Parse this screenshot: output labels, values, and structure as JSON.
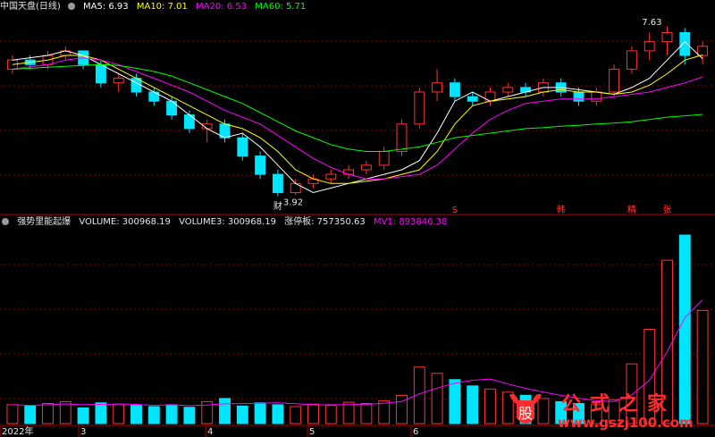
{
  "header": {
    "title": "中国天盘(日线)",
    "ma5": "MA5: 6.93",
    "ma10": "MA10: 7.01",
    "ma20": "MA20: 6.53",
    "ma60": "MA60: 5.71"
  },
  "indicator": {
    "name": "强势里能起爆",
    "volume": "VOLUME: 300968.19",
    "volume3": "VOLUME3: 300968.19",
    "zt": "涨停板: 757350.63",
    "mv1": "MV1: 893846.38"
  },
  "annotations": {
    "high": "7.63",
    "low": "3.92",
    "marker": "财",
    "signals": [
      "S",
      "韩",
      "精",
      "张"
    ]
  },
  "xaxis": [
    "2022年",
    "3",
    "4",
    "5",
    "6"
  ],
  "watermark": {
    "text": "公式之家",
    "url": "www.gszj100.com",
    "logo": "股"
  },
  "colors": {
    "up": "#ff3333",
    "down": "#00e5ff",
    "ma5": "#ffffff",
    "ma10": "#ffff00",
    "ma20": "#ff00ff",
    "ma60": "#00ff00",
    "grid": "#8b0000"
  },
  "chart_data": [
    {
      "type": "candlestick",
      "series": [
        {
          "name": "MA5",
          "values": [
            6.9,
            6.95,
            7.0,
            7.1,
            7.0,
            6.8,
            6.6,
            6.4,
            6.2,
            6.0,
            5.7,
            5.4,
            5.2,
            5.3,
            5.0,
            4.6,
            4.2,
            4.0,
            4.1,
            4.2,
            4.3,
            4.4,
            4.5,
            4.7,
            5.3,
            6.0,
            6.2,
            6.0,
            6.1,
            6.2,
            6.3,
            6.3,
            6.25,
            6.2,
            6.15,
            6.3,
            6.5,
            6.9,
            7.3,
            6.93
          ]
        },
        {
          "name": "MA10",
          "values": [
            6.8,
            6.85,
            6.9,
            7.0,
            7.0,
            6.9,
            6.7,
            6.5,
            6.3,
            6.1,
            5.9,
            5.7,
            5.5,
            5.4,
            5.2,
            4.9,
            4.5,
            4.3,
            4.2,
            4.2,
            4.25,
            4.3,
            4.4,
            4.5,
            4.9,
            5.5,
            5.9,
            6.0,
            6.05,
            6.1,
            6.2,
            6.25,
            6.2,
            6.2,
            6.15,
            6.2,
            6.35,
            6.6,
            6.9,
            7.01
          ]
        },
        {
          "name": "MA20",
          "values": [
            6.7,
            6.75,
            6.8,
            6.9,
            6.95,
            6.9,
            6.8,
            6.65,
            6.5,
            6.35,
            6.2,
            6.0,
            5.8,
            5.65,
            5.5,
            5.25,
            5.0,
            4.75,
            4.55,
            4.4,
            4.3,
            4.3,
            4.35,
            4.4,
            4.6,
            4.95,
            5.3,
            5.6,
            5.8,
            5.95,
            6.0,
            6.05,
            6.05,
            6.05,
            6.1,
            6.15,
            6.2,
            6.3,
            6.4,
            6.53
          ]
        },
        {
          "name": "MA60",
          "values": [
            6.7,
            6.72,
            6.74,
            6.76,
            6.78,
            6.8,
            6.78,
            6.72,
            6.65,
            6.55,
            6.4,
            6.25,
            6.1,
            5.95,
            5.75,
            5.55,
            5.35,
            5.2,
            5.05,
            4.95,
            4.9,
            4.9,
            4.95,
            5.0,
            5.1,
            5.2,
            5.25,
            5.3,
            5.35,
            5.4,
            5.42,
            5.45,
            5.47,
            5.5,
            5.52,
            5.55,
            5.6,
            5.65,
            5.68,
            5.71
          ]
        }
      ],
      "candles": [
        [
          6.7,
          7.0,
          6.6,
          6.9
        ],
        [
          6.9,
          7.0,
          6.7,
          6.8
        ],
        [
          6.8,
          7.1,
          6.7,
          7.0
        ],
        [
          7.0,
          7.2,
          6.9,
          7.1
        ],
        [
          7.1,
          7.1,
          6.7,
          6.8
        ],
        [
          6.8,
          6.9,
          6.3,
          6.4
        ],
        [
          6.4,
          6.6,
          6.2,
          6.5
        ],
        [
          6.5,
          6.6,
          6.1,
          6.2
        ],
        [
          6.2,
          6.3,
          5.9,
          6.0
        ],
        [
          6.0,
          6.1,
          5.6,
          5.7
        ],
        [
          5.7,
          5.8,
          5.3,
          5.4
        ],
        [
          5.4,
          5.6,
          5.1,
          5.5
        ],
        [
          5.5,
          5.6,
          5.1,
          5.2
        ],
        [
          5.2,
          5.3,
          4.7,
          4.8
        ],
        [
          4.8,
          4.9,
          4.3,
          4.4
        ],
        [
          4.4,
          4.5,
          3.92,
          4.0
        ],
        [
          4.0,
          4.3,
          3.95,
          4.2
        ],
        [
          4.2,
          4.4,
          4.1,
          4.3
        ],
        [
          4.3,
          4.5,
          4.2,
          4.4
        ],
        [
          4.4,
          4.6,
          4.3,
          4.5
        ],
        [
          4.5,
          4.7,
          4.4,
          4.6
        ],
        [
          4.6,
          5.0,
          4.5,
          4.9
        ],
        [
          4.9,
          5.6,
          4.8,
          5.5
        ],
        [
          5.5,
          6.3,
          5.4,
          6.2
        ],
        [
          6.2,
          6.7,
          6.0,
          6.4
        ],
        [
          6.4,
          6.5,
          6.0,
          6.1
        ],
        [
          6.1,
          6.2,
          5.9,
          6.0
        ],
        [
          6.0,
          6.3,
          5.9,
          6.2
        ],
        [
          6.2,
          6.4,
          6.1,
          6.3
        ],
        [
          6.3,
          6.4,
          6.1,
          6.2
        ],
        [
          6.2,
          6.5,
          6.1,
          6.4
        ],
        [
          6.4,
          6.5,
          6.1,
          6.2
        ],
        [
          6.2,
          6.3,
          5.9,
          6.0
        ],
        [
          6.0,
          6.3,
          5.9,
          6.2
        ],
        [
          6.2,
          6.8,
          6.1,
          6.7
        ],
        [
          6.7,
          7.2,
          6.6,
          7.1
        ],
        [
          7.1,
          7.5,
          6.9,
          7.3
        ],
        [
          7.3,
          7.63,
          7.0,
          7.5
        ],
        [
          7.5,
          7.6,
          6.8,
          7.0
        ],
        [
          7.0,
          7.3,
          6.8,
          7.2
        ]
      ],
      "ylim": [
        3.6,
        7.9
      ]
    },
    {
      "type": "bar",
      "volumes": [
        30,
        28,
        32,
        35,
        25,
        33,
        31,
        29,
        27,
        30,
        26,
        35,
        40,
        28,
        33,
        30,
        27,
        31,
        29,
        34,
        32,
        36,
        45,
        90,
        80,
        70,
        60,
        55,
        50,
        45,
        40,
        35,
        32,
        30,
        38,
        95,
        150,
        260,
        300,
        180
      ],
      "up_flags": [
        1,
        0,
        1,
        1,
        0,
        0,
        1,
        0,
        0,
        0,
        0,
        1,
        0,
        0,
        0,
        0,
        1,
        1,
        1,
        1,
        1,
        1,
        1,
        1,
        1,
        0,
        0,
        1,
        1,
        0,
        1,
        0,
        0,
        1,
        1,
        1,
        1,
        1,
        0,
        1
      ],
      "ylim": [
        0,
        310
      ]
    }
  ]
}
